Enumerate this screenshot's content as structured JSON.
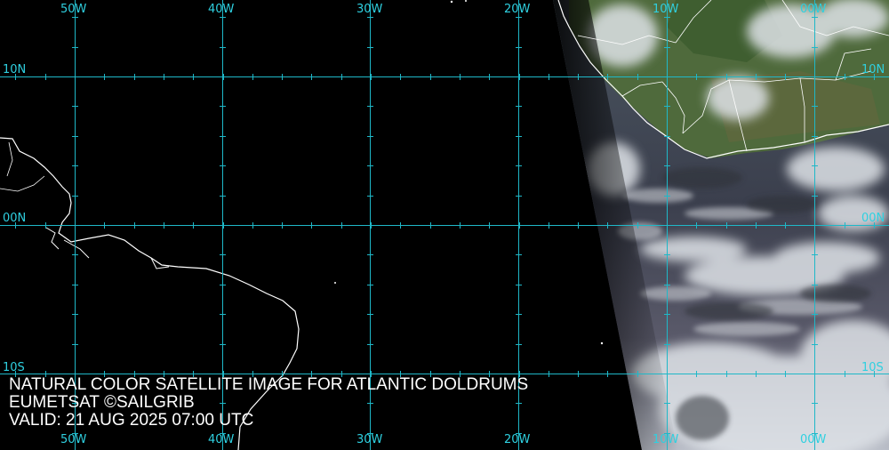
{
  "caption": {
    "title": "NATURAL COLOR SATELLITE IMAGE FOR ATLANTIC DOLDRUMS",
    "credit": "EUMETSAT ©SAILGRIB",
    "valid": "VALID:  21 AUG 2025 07:00 UTC"
  },
  "longitude_labels": [
    "50W",
    "40W",
    "30W",
    "20W",
    "10W",
    "00W"
  ],
  "latitude_labels": [
    "10N",
    "00N",
    "10S"
  ],
  "colors": {
    "grid": "#1fb8c8",
    "label": "#2fd0e0",
    "coastline": "#ffffff",
    "night": "#000000",
    "ocean_day": "#3a4150",
    "land_day": "#4c6a3a",
    "cloud": "#d9dde2"
  }
}
